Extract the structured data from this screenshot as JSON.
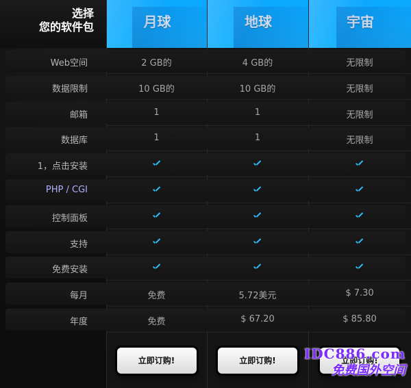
{
  "header": {
    "left_title_line1": "选择",
    "left_title_line2": "您的软件包"
  },
  "plans": [
    {
      "name": "月球"
    },
    {
      "name": "地球"
    },
    {
      "name": "宇宙"
    }
  ],
  "rows": [
    {
      "label": "Web空间",
      "values": [
        "2 GB的",
        "4 GB的",
        "无限制"
      ]
    },
    {
      "label": "数据限制",
      "values": [
        "10 GB的",
        "10 GB的",
        "无限制"
      ]
    },
    {
      "label": "邮箱",
      "values": [
        "1",
        "1",
        "无限制"
      ]
    },
    {
      "label": "数据库",
      "values": [
        "1",
        "1",
        "无限制"
      ]
    },
    {
      "label": "1，点击安装",
      "values": [
        "✓",
        "✓",
        "✓"
      ],
      "check": true
    },
    {
      "label": "PHP / CGI",
      "values": [
        "✓",
        "✓",
        "✓"
      ],
      "check": true
    },
    {
      "label": "控制面板",
      "values": [
        "✓",
        "✓",
        "✓"
      ],
      "check": true
    },
    {
      "label": "支持",
      "values": [
        "✓",
        "✓",
        "✓"
      ],
      "check": true
    },
    {
      "label": "免费安装",
      "values": [
        "✓",
        "✓",
        "✓"
      ],
      "check": true
    },
    {
      "label": "每月",
      "values": [
        "免费",
        "5.72美元",
        "$ 7.30"
      ]
    },
    {
      "label": "年度",
      "values": [
        "免费",
        "$ 67.20",
        "$ 85.80"
      ]
    }
  ],
  "buttons": {
    "order_label": "立即订购!"
  },
  "watermark": {
    "line1": "IDC886.com",
    "line2": "免费国外空间"
  },
  "colors": {
    "accent_blue": "#18b2ff",
    "check_blue": "#2cc2ff",
    "watermark_purple": "#7b2cff"
  }
}
